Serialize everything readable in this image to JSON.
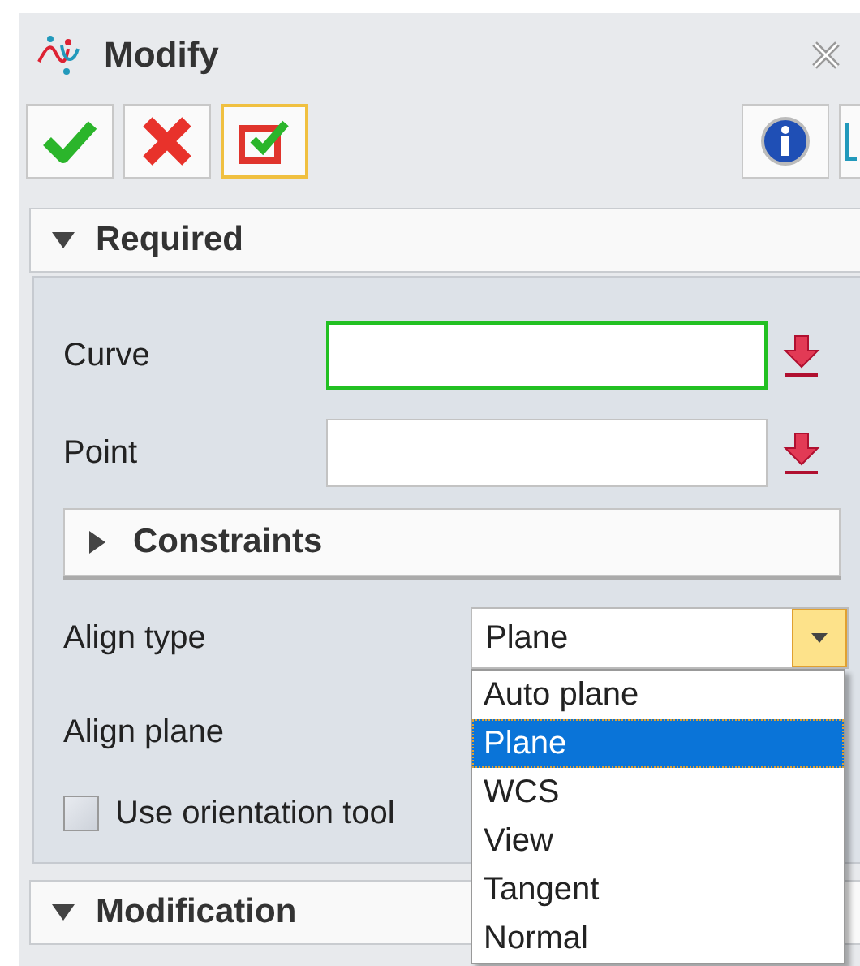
{
  "window": {
    "title": "Modify"
  },
  "toolbar": [
    {
      "kind": "ok"
    },
    {
      "kind": "cancel"
    },
    {
      "kind": "apply",
      "selected": true
    },
    {
      "kind": "info"
    }
  ],
  "required": {
    "title": "Required",
    "expanded": true,
    "fields": [
      {
        "label": "Curve",
        "focused": true
      },
      {
        "label": "Point",
        "focused": false
      }
    ],
    "constraints": {
      "title": "Constraints",
      "expanded": false
    },
    "align_type": {
      "label": "Align type",
      "value": "Plane",
      "open": true,
      "options": [
        {
          "label": "Auto plane",
          "selected": false
        },
        {
          "label": "Plane",
          "selected": true
        },
        {
          "label": "WCS",
          "selected": false
        },
        {
          "label": "View",
          "selected": false
        },
        {
          "label": "Tangent",
          "selected": false
        },
        {
          "label": "Normal",
          "selected": false
        }
      ]
    },
    "align_plane": {
      "label": "Align plane"
    },
    "use_orientation_tool": {
      "label": "Use orientation tool",
      "checked": false
    }
  },
  "modification": {
    "title": "Modification",
    "expanded": true
  }
}
